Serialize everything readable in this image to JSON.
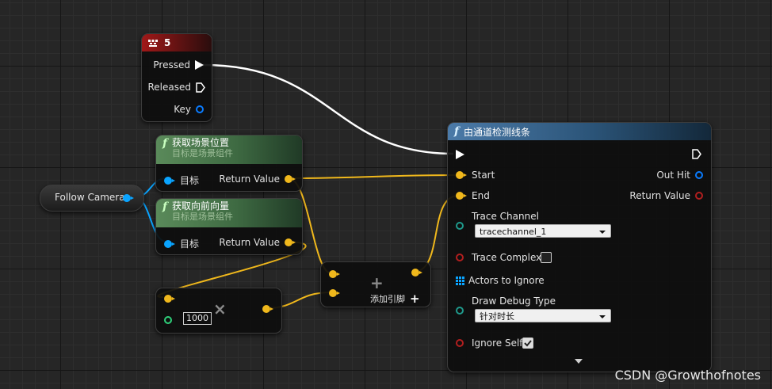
{
  "colors": {
    "exec_wire": "#ffffff",
    "vector_wire": "#f0b81c",
    "object_wire": "#0aa4ff",
    "hit_result": "#0a7cff",
    "bool": "#b21f1f",
    "enum": "#1f9a8c"
  },
  "key_node": {
    "title": "5",
    "icon": "keyboard-icon",
    "pins": {
      "pressed": "Pressed",
      "released": "Released",
      "key": "Key"
    }
  },
  "get_location_node": {
    "title": "获取场景位置",
    "subtitle": "目标是场景组件",
    "target_label": "目标",
    "return_label": "Return Value"
  },
  "get_forward_node": {
    "title": "获取向前向量",
    "subtitle": "目标是场景组件",
    "target_label": "目标",
    "return_label": "Return Value"
  },
  "camera_node": {
    "label": "Follow Camera"
  },
  "multiply_node": {
    "value": "1000",
    "operator": "×"
  },
  "add_node": {
    "operator": "+",
    "add_pin_label": "添加引脚"
  },
  "trace_node": {
    "title": "由通道检测线条",
    "start_label": "Start",
    "end_label": "End",
    "out_hit_label": "Out Hit",
    "return_label": "Return Value",
    "trace_channel_label": "Trace Channel",
    "trace_channel_value": "tracechannel_1",
    "trace_complex_label": "Trace Complex",
    "trace_complex_checked": false,
    "actors_to_ignore_label": "Actors to Ignore",
    "draw_debug_label": "Draw Debug Type",
    "draw_debug_value": "针对时长",
    "ignore_self_label": "Ignore Self",
    "ignore_self_checked": true
  },
  "watermark": "CSDN @Growthofnotes"
}
